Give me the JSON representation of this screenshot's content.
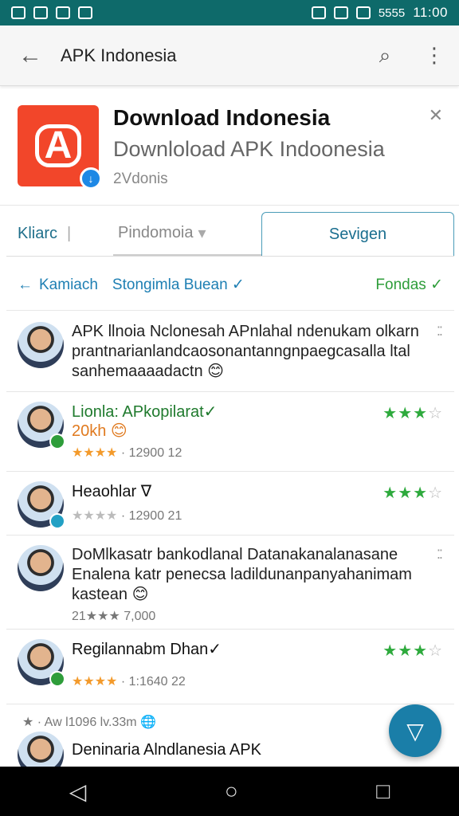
{
  "status_bar": {
    "time": "11:00",
    "network_label": "5555",
    "left_icons": [
      "notification-icon",
      "message-icon",
      "mail-icon",
      "app-icon"
    ],
    "right_icons": [
      "vibrate-icon",
      "wifi-icon",
      "data-icon",
      "signal-icon"
    ]
  },
  "app_bar": {
    "title": "APK Indonesia",
    "back_icon": "←",
    "search_icon": "⌕",
    "overflow_icon": "⋮"
  },
  "app_header": {
    "name": "Download Indonesia",
    "subtitle": "Downloload APK Indoonesia",
    "meta": "2Vdonis",
    "icon_glyph": "A",
    "badge_glyph": "↓",
    "close_icon": "✕"
  },
  "tabs": {
    "tab1": "Kliarc",
    "tab1_sep": "|",
    "tab2": "Pindomoia",
    "tab2_caret": "▾",
    "tab3": "Sevigen"
  },
  "filter": {
    "back_arrow": "←",
    "back_label": "Kamiach",
    "sort_label": "Stongimla Buean ✓",
    "right_label": "Fondas ✓"
  },
  "reviews": [
    {
      "text_line1": "APK llnoia Nclonesah APnlahal ndenukam olkarn",
      "text_line2": "prantnarianlandcaosonantanngnpaegcasalla ltal",
      "text_line3": "sanhemaaaadactn 😊",
      "dots": "⁚⁚"
    },
    {
      "title": "Lionla: APkopilarat✓",
      "highlight": "20kh 😊",
      "stars_meta": "★★★★",
      "meta": "· 12900  12",
      "rating": "★★★",
      "rating_empty": "☆"
    },
    {
      "title": "Heaohlar ∇",
      "stars_meta": "★★★★",
      "meta": "· 12900  21",
      "rating": "★★★",
      "rating_empty": "☆"
    },
    {
      "text_line1": "DoMlkasatr bankodlanal Datanakanalanasane",
      "text_line2": "Enalena katr penecsa ladildunanpanyahanimam",
      "text_line3": "kastean 😊",
      "meta": "21★★★  7,000",
      "dots": "⁚⁚"
    },
    {
      "title": "Regilannabm Dhan✓",
      "stars_meta": "★★★★",
      "meta": "· 1:1640  22",
      "rating": "★★★",
      "rating_empty": "☆"
    },
    {
      "meta": "★ · Aw  l1096   lv.33m 🌐",
      "title": "Deninaria Alndlanesia APK"
    }
  ],
  "fab_icon": "▽",
  "nav": {
    "back": "◁",
    "home": "○",
    "recents": "□"
  }
}
